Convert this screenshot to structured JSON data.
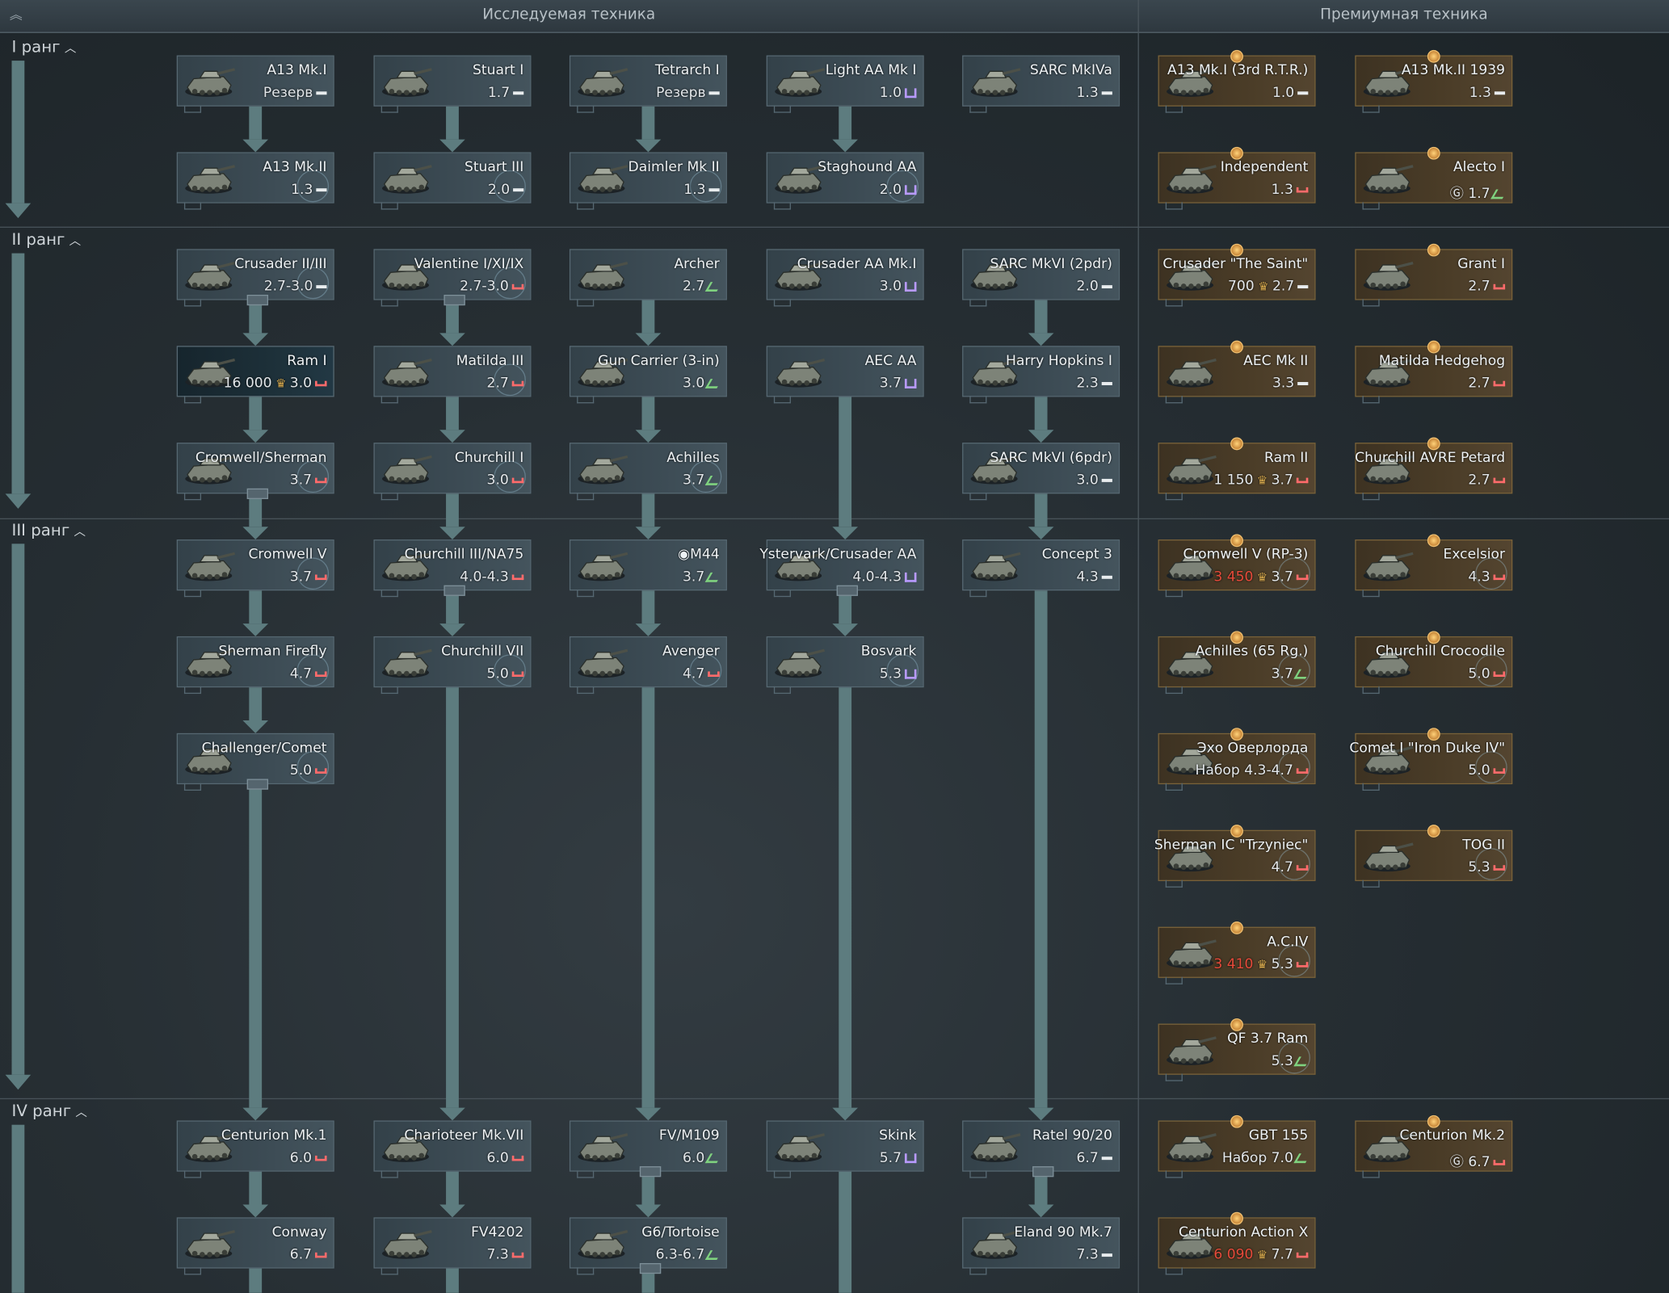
{
  "header": {
    "researchable": "Исследуемая техника",
    "premium": "Премиумная техника"
  },
  "ranks": [
    "I ранг",
    "II ранг",
    "III ранг",
    "IV ранг"
  ],
  "colors": {
    "connector": "#5d7c7f",
    "premium_border": "#7a6238",
    "research_bg": "#3c4b54"
  },
  "vehicles": {
    "r1": [
      {
        "name": "A13 Mk.I",
        "br": "Резерв",
        "cls": "ic-rank"
      },
      {
        "name": "Stuart I",
        "br": "1.7",
        "cls": "ic-rank"
      },
      {
        "name": "Tetrarch I",
        "br": "Резерв",
        "cls": "ic-rank"
      },
      {
        "name": "Light AA Mk I",
        "br": "1.0",
        "cls": "ic-aa"
      },
      {
        "name": "SARC MkIVa",
        "br": "1.3",
        "cls": "ic-rank"
      },
      {
        "name": "A13 Mk.II",
        "br": "1.3",
        "cls": "ic-rank"
      },
      {
        "name": "Stuart III",
        "br": "2.0",
        "cls": "ic-rank"
      },
      {
        "name": "Daimler Mk II",
        "br": "1.3",
        "cls": "ic-rank"
      },
      {
        "name": "Staghound AA",
        "br": "2.0",
        "cls": "ic-aa"
      }
    ],
    "r2": [
      {
        "name": "Crusader II/III",
        "br": "2.7-3.0",
        "cls": "ic-rank"
      },
      {
        "name": "Valentine I/XI/IX",
        "br": "2.7-3.0",
        "cls": "ic-med"
      },
      {
        "name": "Archer",
        "br": "2.7",
        "cls": "ic-spg"
      },
      {
        "name": "Crusader AA Mk.I",
        "br": "3.0",
        "cls": "ic-aa"
      },
      {
        "name": "SARC MkVI (2pdr)",
        "br": "2.0",
        "cls": "ic-rank"
      },
      {
        "name": "Ram I",
        "cost": "16 000",
        "br": "3.0",
        "cls": "ic-med"
      },
      {
        "name": "Matilda III",
        "br": "2.7",
        "cls": "ic-med"
      },
      {
        "name": "Gun Carrier (3-in)",
        "br": "3.0",
        "cls": "ic-spg"
      },
      {
        "name": "AEC AA",
        "br": "3.7",
        "cls": "ic-aa"
      },
      {
        "name": "Harry Hopkins I",
        "br": "2.3",
        "cls": "ic-rank"
      },
      {
        "name": "Cromwell/Sherman",
        "br": "3.7",
        "cls": "ic-med"
      },
      {
        "name": "Churchill I",
        "br": "3.0",
        "cls": "ic-med"
      },
      {
        "name": "Achilles",
        "br": "3.7",
        "cls": "ic-spg"
      },
      {
        "name": "SARC MkVI (6pdr)",
        "br": "3.0",
        "cls": "ic-rank"
      }
    ],
    "r3": [
      {
        "name": "Cromwell V",
        "br": "3.7",
        "cls": "ic-med"
      },
      {
        "name": "Churchill III/NA75",
        "br": "4.0-4.3",
        "cls": "ic-med"
      },
      {
        "name": "◉M44",
        "br": "3.7",
        "cls": "ic-spg"
      },
      {
        "name": "Ystervark/Crusader AA",
        "br": "4.0-4.3",
        "cls": "ic-aa"
      },
      {
        "name": "Concept 3",
        "br": "4.3",
        "cls": "ic-rank"
      },
      {
        "name": "Sherman Firefly",
        "br": "4.7",
        "cls": "ic-med"
      },
      {
        "name": "Churchill VII",
        "br": "5.0",
        "cls": "ic-med"
      },
      {
        "name": "Avenger",
        "br": "4.7",
        "cls": "ic-med"
      },
      {
        "name": "Bosvark",
        "br": "5.3",
        "cls": "ic-aa"
      },
      {
        "name": "Challenger/Comet",
        "br": "5.0",
        "cls": "ic-med"
      }
    ],
    "r4": [
      {
        "name": "Centurion Mk.1",
        "br": "6.0",
        "cls": "ic-med"
      },
      {
        "name": "Charioteer Mk.VII",
        "br": "6.0",
        "cls": "ic-med"
      },
      {
        "name": "FV/M109",
        "br": "6.0",
        "cls": "ic-spg"
      },
      {
        "name": "Skink",
        "br": "5.7",
        "cls": "ic-aa"
      },
      {
        "name": "Ratel 90/20",
        "br": "6.7",
        "cls": "ic-rank"
      },
      {
        "name": "Conway",
        "br": "6.7",
        "cls": "ic-med"
      },
      {
        "name": "FV4202",
        "br": "7.3",
        "cls": "ic-med"
      },
      {
        "name": "G6/Tortoise",
        "br": "6.3-6.7",
        "cls": "ic-spg"
      },
      {
        "name": "Eland 90 Mk.7",
        "br": "7.3",
        "cls": "ic-rank"
      }
    ],
    "prem": [
      {
        "name": "A13 Mk.I (3rd R.T.R.)",
        "br": "1.0",
        "cls": "ic-rank"
      },
      {
        "name": "A13 Mk.II 1939",
        "br": "1.3",
        "cls": "ic-rank"
      },
      {
        "name": "Independent",
        "br": "1.3",
        "cls": "ic-med"
      },
      {
        "name": "Alecto I",
        "prefix": "Ⓖ",
        "br": "1.7",
        "cls": "ic-spg"
      },
      {
        "name": "Crusader \"The Saint\"",
        "cost": "700",
        "br": "2.7",
        "cls": "ic-rank"
      },
      {
        "name": "Grant I",
        "br": "2.7",
        "cls": "ic-med"
      },
      {
        "name": "AEC Mk II",
        "br": "3.3",
        "cls": "ic-rank"
      },
      {
        "name": "Matilda Hedgehog",
        "br": "2.7",
        "cls": "ic-med"
      },
      {
        "name": "Ram II",
        "cost": "1 150",
        "br": "3.7",
        "cls": "ic-med"
      },
      {
        "name": "Churchill AVRE Petard",
        "br": "2.7",
        "cls": "ic-med"
      },
      {
        "name": "Cromwell V (RP-3)",
        "cost": "3 450",
        "costred": true,
        "br": "3.7",
        "cls": "ic-med"
      },
      {
        "name": "Excelsior",
        "br": "4.3",
        "cls": "ic-med"
      },
      {
        "name": "Achilles (65 Rg.)",
        "br": "3.7",
        "cls": "ic-spg"
      },
      {
        "name": "Churchill Crocodile",
        "br": "5.0",
        "cls": "ic-med"
      },
      {
        "name": "Эхо Оверлорда",
        "br": "Набор 4.3-4.7",
        "cls": "ic-med"
      },
      {
        "name": "Comet I \"Iron Duke IV\"",
        "br": "5.0",
        "cls": "ic-med"
      },
      {
        "name": "Sherman IC \"Trzyniec\"",
        "br": "4.7",
        "cls": "ic-med"
      },
      {
        "name": "TOG II",
        "br": "5.3",
        "cls": "ic-med"
      },
      {
        "name": "A.C.IV",
        "cost": "3 410",
        "costred": true,
        "br": "5.3",
        "cls": "ic-med"
      },
      {
        "name": "QF 3.7 Ram",
        "br": "5.3",
        "cls": "ic-spg"
      },
      {
        "name": "GBT 155",
        "br": "Набор 7.0",
        "cls": "ic-spg"
      },
      {
        "name": "Centurion Mk.2",
        "prefix": "Ⓖ",
        "br": "6.7",
        "cls": "ic-med"
      },
      {
        "name": "Centurion Action X",
        "cost": "6 090",
        "costred": true,
        "br": "7.7",
        "cls": "ic-med"
      }
    ]
  }
}
